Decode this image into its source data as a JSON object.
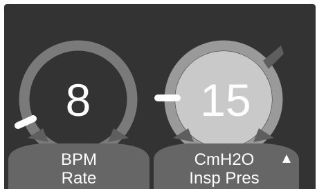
{
  "controls": [
    {
      "id": "rate",
      "value": "8",
      "unit": "BPM",
      "label": "Rate",
      "selected": false,
      "alarm_indicator": false
    },
    {
      "id": "insp-pres",
      "value": "15",
      "unit": "CmH2O",
      "label": "Insp Pres",
      "selected": true,
      "alarm_indicator": true
    }
  ],
  "colors": {
    "background": "#333333",
    "ring": "#7a7a7a",
    "ring_selected": "#9a9a9a",
    "knob_fill_selected": "#c9c9c9",
    "label_tab": "#666666",
    "text": "#ffffff",
    "indicator": "#ffffff"
  }
}
